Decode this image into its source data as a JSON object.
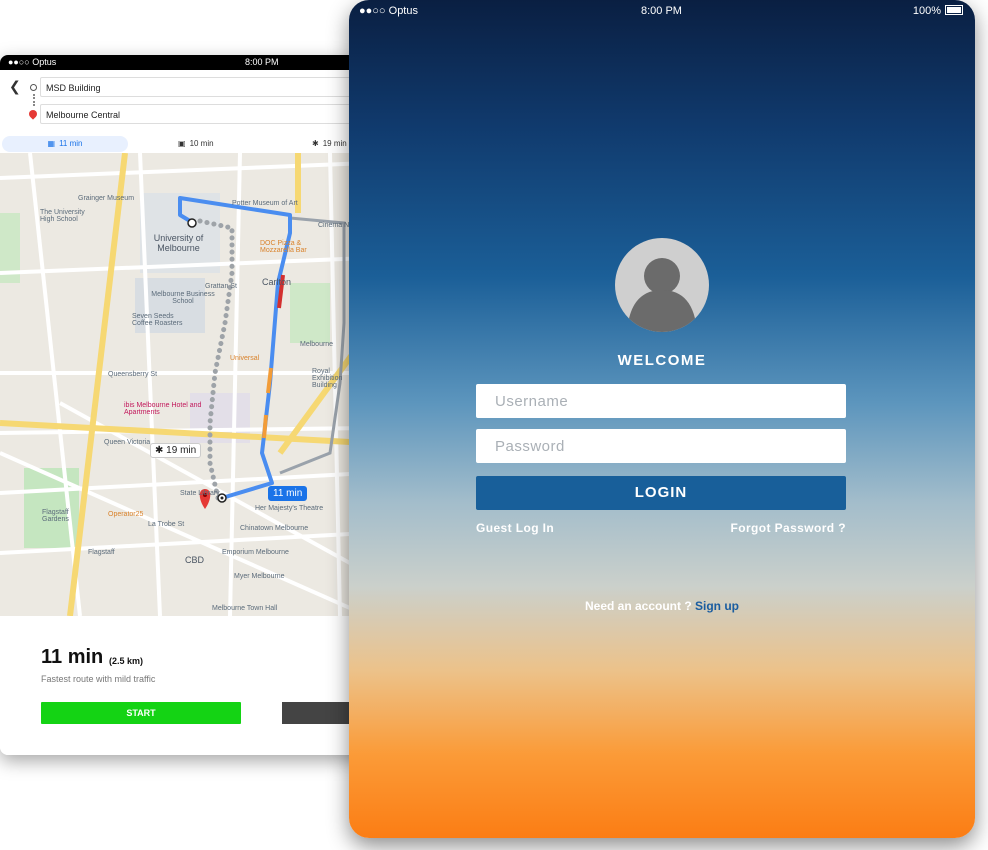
{
  "map_app": {
    "status": {
      "carrier": "●●○○ Optus",
      "time": "8:00 PM"
    },
    "route": {
      "from": "MSD Building",
      "to": "Melbourne Central"
    },
    "modes": [
      {
        "icon": "car-icon",
        "label": "11 min"
      },
      {
        "icon": "transit-icon",
        "label": "10 min"
      },
      {
        "icon": "walk-icon",
        "label": "19 min"
      }
    ],
    "map_labels": [
      "Grainger Museum",
      "The University High School",
      "University of Melbourne",
      "Potter Museum of Art",
      "Cinema Nova",
      "DOC Pizza & Mozzarella Bar",
      "Carlton",
      "Melbourne Business School",
      "Seven Seeds Coffee Roasters",
      "Universal",
      "Queensberry St",
      "ibis Melbourne Hotel and Apartments",
      "Queen Victoria",
      "Royal Exhibition Building",
      "Melbourne",
      "Flagstaff Gardens",
      "Operator25",
      "Her Majesty's Theatre",
      "Chinatown Melbourne",
      "Emporium Melbourne",
      "CBD",
      "Flagstaff",
      "Myer Melbourne",
      "Melbourne Town Hall",
      "La Trobe St",
      "Grattan St",
      "State Library"
    ],
    "walk_chip": "19 min",
    "drive_chip": "11 min",
    "eta": "11 min",
    "distance": "(2.5 km)",
    "traffic_note": "Fastest route with mild traffic",
    "start_label": "START"
  },
  "login": {
    "status": {
      "carrier": "●●○○ Optus",
      "time": "8:00 PM",
      "battery": "100%"
    },
    "welcome": "WELCOME",
    "username_placeholder": "Username",
    "password_placeholder": "Password",
    "login_label": "LOGIN",
    "guest_label": "Guest Log In",
    "forgot_label": "Forgot Password ?",
    "signup_prompt": "Need an account ?",
    "signup_label": "Sign up",
    "colors": {
      "login_button": "#185f9a",
      "signup_link": "#1a5da0"
    }
  }
}
